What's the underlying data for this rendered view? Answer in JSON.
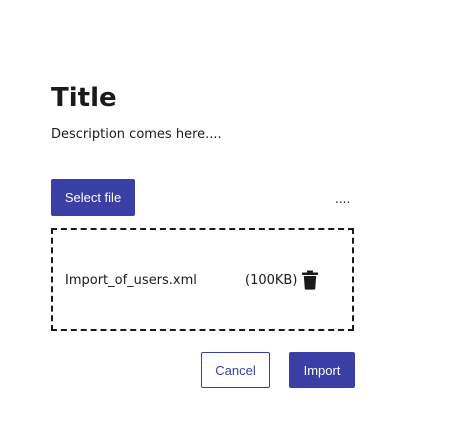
{
  "dialog": {
    "title": "Title",
    "description": "Description comes here....",
    "select_file_label": "Select file",
    "file_hint": "....",
    "file": {
      "name": "Import_of_users.xml",
      "size": "(100KB)",
      "delete_icon": "trash-icon"
    },
    "cancel_label": "Cancel",
    "import_label": "Import"
  },
  "colors": {
    "primary": "#3a3fa6",
    "text": "#1a1a1a",
    "background": "#ffffff"
  }
}
